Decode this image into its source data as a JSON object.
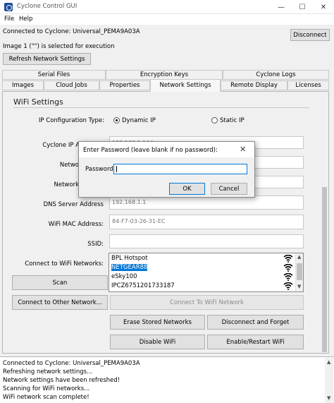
{
  "window": {
    "title": "Cyclone Control GUI",
    "minimize": "—",
    "maximize": "☐",
    "close": "✕"
  },
  "menu": [
    "File",
    "Help"
  ],
  "connection": {
    "status": "Connected to Cyclone: Universal_PEMA9A03A",
    "disconnect_label": "Disconnect",
    "image_status": "Image 1 (\"\") is selected for execution",
    "refresh_label": "Refresh Network Settings"
  },
  "tabs": {
    "row1": [
      "Serial Files",
      "Encryption Keys",
      "Cyclone Logs"
    ],
    "row2": [
      "Images",
      "Cloud Jobs",
      "Properties",
      "Network Settings",
      "Remote Display",
      "Licenses"
    ],
    "active": "Network Settings"
  },
  "wifi": {
    "heading": "WiFi Settings",
    "ip_config_label": "IP Configuration Type:",
    "dynamic_ip": "Dynamic IP",
    "static_ip": "Static IP",
    "selected": "Dynamic IP",
    "ip_label": "Cyclone IP A",
    "ip_value": "192.168.1.164",
    "netmask_label": "Netwo",
    "gateway_label": "Network",
    "dns_label": "DNS Server Address",
    "dns_value": "192.168.1.1",
    "mac_label": "WiFi MAC Address:",
    "mac_value": "84-F7-03-26-31-EC",
    "ssid_label": "SSID:",
    "ssid_value": "",
    "connect_label": "Connect to WiFi Networks:",
    "networks": [
      {
        "name": "BPL Hotspot",
        "selected": false,
        "signal": "wifi-strong-icon"
      },
      {
        "name": "NETGEAR88",
        "selected": true,
        "signal": "wifi-strong-icon"
      },
      {
        "name": "eSky100",
        "selected": false,
        "signal": "wifi-strong-icon"
      },
      {
        "name": "IPCZ6751201733187",
        "selected": false,
        "signal": "wifi-strong-icon"
      }
    ],
    "scan_label": "Scan",
    "connect_other_label": "Connect to Other Network...",
    "connect_wifi_label": "Connect To WiFi Network",
    "erase_label": "Erase Stored Networks",
    "disconnect_forget_label": "Disconnect and Forget",
    "disable_label": "Disable WiFi",
    "enable_label": "Enable/Restart WiFi"
  },
  "log": [
    "Connected to Cyclone: Universal_PEMA9A03A",
    "Refreshing network settings...",
    "Network settings have been refreshed!",
    "Scanning for WiFi networks...",
    "WiFi network scan complete!"
  ],
  "dialog": {
    "title": "Enter Password (leave blank if no password):",
    "password_label": "Password",
    "password_value": "",
    "ok_label": "OK",
    "cancel_label": "Cancel"
  },
  "colors": {
    "selection": "#0078d7",
    "accent_icon": "#1f4e9c"
  }
}
